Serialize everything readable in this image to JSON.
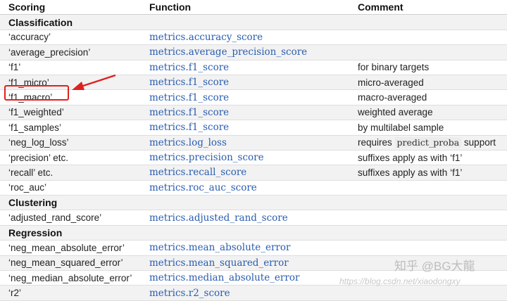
{
  "headers": {
    "scoring": "Scoring",
    "function": "Function",
    "comment": "Comment"
  },
  "rows": [
    {
      "type": "section",
      "label": "Classification"
    },
    {
      "type": "item",
      "scoring": "‘accuracy’",
      "function": "metrics.accuracy_score",
      "comment": ""
    },
    {
      "type": "item",
      "scoring": "‘average_precision’",
      "function": "metrics.average_precision_score",
      "comment": ""
    },
    {
      "type": "item",
      "scoring": "‘f1’",
      "function": "metrics.f1_score",
      "comment": "for binary targets"
    },
    {
      "type": "item",
      "scoring": "‘f1_micro’",
      "function": "metrics.f1_score",
      "comment": "micro-averaged"
    },
    {
      "type": "item",
      "scoring": "‘f1_macro’",
      "function": "metrics.f1_score",
      "comment": "macro-averaged"
    },
    {
      "type": "item",
      "scoring": "‘f1_weighted’",
      "function": "metrics.f1_score",
      "comment": "weighted average"
    },
    {
      "type": "item",
      "scoring": "‘f1_samples’",
      "function": "metrics.f1_score",
      "comment": "by multilabel sample"
    },
    {
      "type": "item",
      "scoring": "‘neg_log_loss’",
      "function": "metrics.log_loss",
      "comment": "requires",
      "comment_code": "predict_proba",
      "comment_tail": "support"
    },
    {
      "type": "item",
      "scoring": "‘precision’ etc.",
      "function": "metrics.precision_score",
      "comment": "suffixes apply as with ‘f1’"
    },
    {
      "type": "item",
      "scoring": "‘recall’ etc.",
      "function": "metrics.recall_score",
      "comment": "suffixes apply as with ‘f1’"
    },
    {
      "type": "item",
      "scoring": "‘roc_auc’",
      "function": "metrics.roc_auc_score",
      "comment": ""
    },
    {
      "type": "section",
      "label": "Clustering"
    },
    {
      "type": "item",
      "scoring": "‘adjusted_rand_score’",
      "function": "metrics.adjusted_rand_score",
      "comment": ""
    },
    {
      "type": "section",
      "label": "Regression"
    },
    {
      "type": "item",
      "scoring": "‘neg_mean_absolute_error’",
      "function": "metrics.mean_absolute_error",
      "comment": ""
    },
    {
      "type": "item",
      "scoring": "‘neg_mean_squared_error’",
      "function": "metrics.mean_squared_error",
      "comment": ""
    },
    {
      "type": "item",
      "scoring": "‘neg_median_absolute_error’",
      "function": "metrics.median_absolute_error",
      "comment": ""
    },
    {
      "type": "item",
      "scoring": "‘r2’",
      "function": "metrics.r2_score",
      "comment": ""
    }
  ],
  "annotation": {
    "color": "#e02020",
    "target_row": 5
  },
  "watermark": {
    "text": "知乎 @BG大龍",
    "url": "https://blog.csdn.net/xiaodongxy"
  },
  "colors": {
    "function_text": "#2a5db0",
    "stripe": "#f2f2f2"
  }
}
